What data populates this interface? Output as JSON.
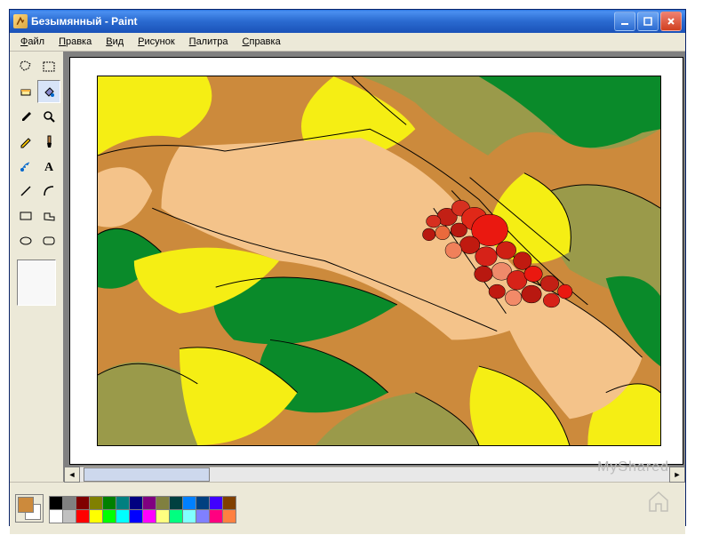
{
  "title": "Безымянный - Paint",
  "menus": [
    "Файл",
    "Правка",
    "Вид",
    "Рисунок",
    "Палитра",
    "Справка"
  ],
  "tools": [
    {
      "name": "free-select-icon"
    },
    {
      "name": "rect-select-icon"
    },
    {
      "name": "eraser-icon"
    },
    {
      "name": "fill-icon",
      "selected": true
    },
    {
      "name": "eyedropper-icon"
    },
    {
      "name": "magnifier-icon"
    },
    {
      "name": "pencil-icon"
    },
    {
      "name": "brush-icon"
    },
    {
      "name": "airbrush-icon"
    },
    {
      "name": "text-icon"
    },
    {
      "name": "line-icon"
    },
    {
      "name": "curve-icon"
    },
    {
      "name": "rectangle-icon"
    },
    {
      "name": "polygon-icon"
    },
    {
      "name": "ellipse-icon"
    },
    {
      "name": "rounded-rect-icon"
    }
  ],
  "colors": {
    "fg": "#cc8a3c",
    "bg": "#ffffff",
    "row1": [
      "#000000",
      "#808080",
      "#800000",
      "#808000",
      "#008000",
      "#008080",
      "#000080",
      "#800080",
      "#808040",
      "#004040",
      "#0080ff",
      "#004080",
      "#4000ff",
      "#804000"
    ],
    "row2": [
      "#ffffff",
      "#c0c0c0",
      "#ff0000",
      "#ffff00",
      "#00ff00",
      "#00ffff",
      "#0000ff",
      "#ff00ff",
      "#ffff80",
      "#00ff80",
      "#80ffff",
      "#8080ff",
      "#ff0080",
      "#ff8040"
    ]
  },
  "watermark": "MyShared"
}
